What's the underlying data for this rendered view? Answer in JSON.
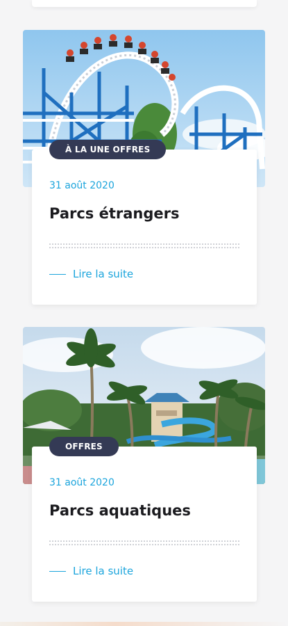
{
  "articles": [
    {
      "badge": "À LA UNE OFFRES",
      "date": "31 août 2020",
      "title": "Parcs étrangers",
      "read_more": "Lire la suite",
      "image_subject": "roller-coaster"
    },
    {
      "badge": "OFFRES",
      "date": "31 août 2020",
      "title": "Parcs aquatiques",
      "read_more": "Lire la suite",
      "image_subject": "water-park-palm-trees"
    }
  ],
  "colors": {
    "accent": "#1aa4dc",
    "badge_bg": "#343a55",
    "title": "#1b1b1f",
    "page_bg": "#f5f5f6"
  }
}
